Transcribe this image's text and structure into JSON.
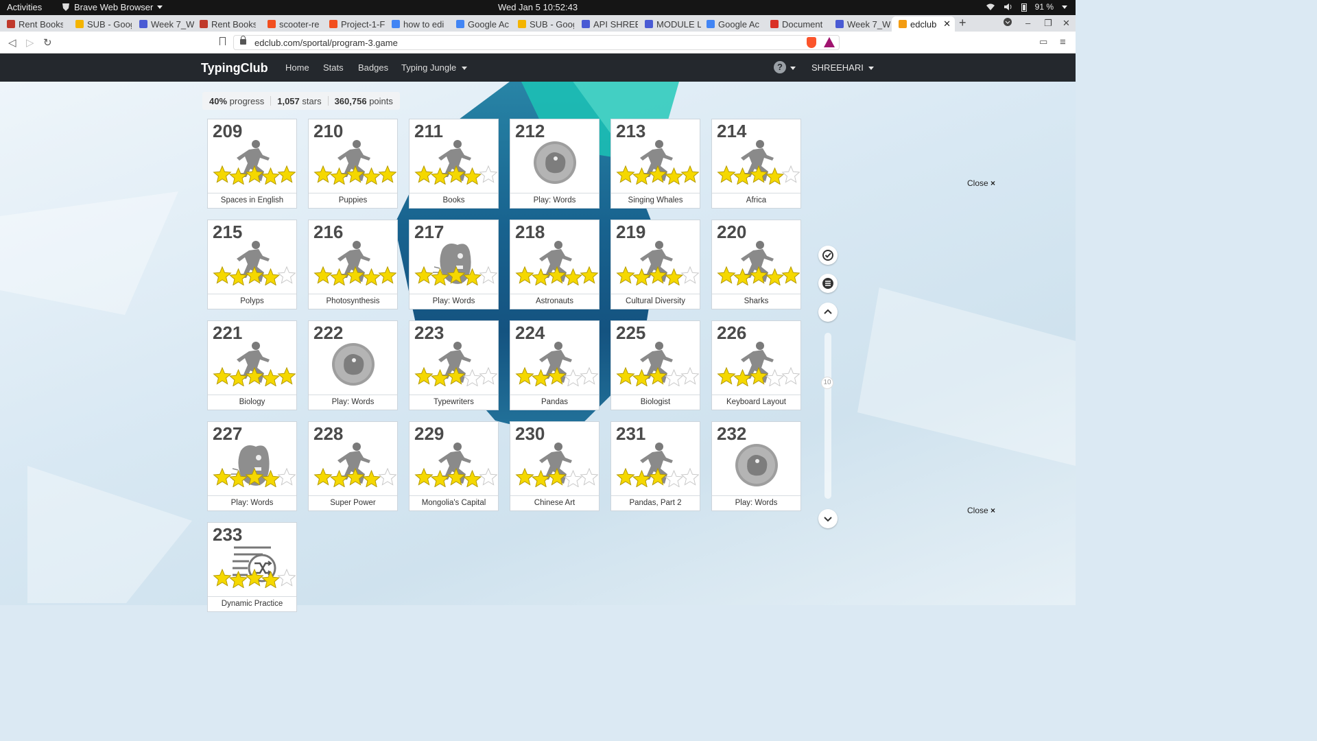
{
  "system_bar": {
    "activities": "Activities",
    "app_name": "Brave Web Browser",
    "clock": "Wed Jan 5  10:52:43",
    "battery": "91 %"
  },
  "tabs": [
    {
      "label": "Rent Books",
      "icon": "bf-icon",
      "color": "#c0392b"
    },
    {
      "label": "SUB - Goog",
      "icon": "drive-icon",
      "color": "#f4b400"
    },
    {
      "label": "Week 7_W",
      "icon": "docs-icon",
      "color": "#4a5bd4"
    },
    {
      "label": "Rent Books",
      "icon": "bf-icon",
      "color": "#c0392b"
    },
    {
      "label": "scooter-re",
      "icon": "figma-icon",
      "color": "#f24e1e"
    },
    {
      "label": "Project-1-F",
      "icon": "figma-icon",
      "color": "#f24e1e"
    },
    {
      "label": "how to edi",
      "icon": "google-icon",
      "color": "#4285f4"
    },
    {
      "label": "Google Ac",
      "icon": "google-icon",
      "color": "#4285f4"
    },
    {
      "label": "SUB - Goog",
      "icon": "drive-icon",
      "color": "#f4b400"
    },
    {
      "label": "API SHREE",
      "icon": "docs-icon",
      "color": "#4a5bd4"
    },
    {
      "label": "MODULE L",
      "icon": "docs-icon",
      "color": "#4a5bd4"
    },
    {
      "label": "Google Ac",
      "icon": "google-icon",
      "color": "#4285f4"
    },
    {
      "label": "Document",
      "icon": "gmail-icon",
      "color": "#d93025"
    },
    {
      "label": "Week 7_W",
      "icon": "docs-icon",
      "color": "#4a5bd4"
    },
    {
      "label": "edclub",
      "icon": "edclub-icon",
      "color": "#f39c12",
      "active": true
    }
  ],
  "address_bar": {
    "url": "edclub.com/sportal/program-3.game"
  },
  "app_nav": {
    "brand": "TypingClub",
    "links": [
      "Home",
      "Stats",
      "Badges",
      "Typing Jungle"
    ],
    "help": "?",
    "user": "SHREEHARI"
  },
  "stats": {
    "progress_value": "40%",
    "progress_label": "progress",
    "stars_value": "1,057",
    "stars_label": "stars",
    "points_value": "360,756",
    "points_label": "points"
  },
  "lessons": [
    {
      "num": "209",
      "title": "Spaces in English",
      "type": "runner",
      "stars": 5
    },
    {
      "num": "210",
      "title": "Puppies",
      "type": "runner",
      "stars": 5
    },
    {
      "num": "211",
      "title": "Books",
      "type": "runner",
      "stars": 4
    },
    {
      "num": "212",
      "title": "Play: Words",
      "type": "game-locked",
      "stars": 0
    },
    {
      "num": "213",
      "title": "Singing Whales",
      "type": "runner",
      "stars": 5
    },
    {
      "num": "214",
      "title": "Africa",
      "type": "runner",
      "stars": 4
    },
    {
      "num": "215",
      "title": "Polyps",
      "type": "runner",
      "stars": 4
    },
    {
      "num": "216",
      "title": "Photosynthesis",
      "type": "runner",
      "stars": 5
    },
    {
      "num": "217",
      "title": "Play: Words",
      "type": "game",
      "stars": 4
    },
    {
      "num": "218",
      "title": "Astronauts",
      "type": "runner",
      "stars": 5
    },
    {
      "num": "219",
      "title": "Cultural Diversity",
      "type": "runner",
      "stars": 4
    },
    {
      "num": "220",
      "title": "Sharks",
      "type": "runner",
      "stars": 5
    },
    {
      "num": "221",
      "title": "Biology",
      "type": "runner",
      "stars": 5
    },
    {
      "num": "222",
      "title": "Play: Words",
      "type": "game-locked",
      "stars": 0
    },
    {
      "num": "223",
      "title": "Typewriters",
      "type": "runner",
      "stars": 3
    },
    {
      "num": "224",
      "title": "Pandas",
      "type": "runner",
      "stars": 3
    },
    {
      "num": "225",
      "title": "Biologist",
      "type": "runner",
      "stars": 3
    },
    {
      "num": "226",
      "title": "Keyboard Layout",
      "type": "runner",
      "stars": 3
    },
    {
      "num": "227",
      "title": "Play: Words",
      "type": "game",
      "stars": 4
    },
    {
      "num": "228",
      "title": "Super Power",
      "type": "runner",
      "stars": 4
    },
    {
      "num": "229",
      "title": "Mongolia's Capital",
      "type": "runner",
      "stars": 4
    },
    {
      "num": "230",
      "title": "Chinese Art",
      "type": "runner",
      "stars": 3
    },
    {
      "num": "231",
      "title": "Pandas, Part 2",
      "type": "runner",
      "stars": 3
    },
    {
      "num": "232",
      "title": "Play: Words",
      "type": "game-locked",
      "stars": 0
    },
    {
      "num": "233",
      "title": "Dynamic Practice",
      "type": "shuffle",
      "stars": 4
    }
  ],
  "side": {
    "close_label": "Close",
    "close_icon": "×",
    "page_indicator": "10"
  },
  "colors": {
    "star_fill": "#f5d800",
    "star_outline": "#b59b00",
    "nav_bg": "#24282d"
  }
}
